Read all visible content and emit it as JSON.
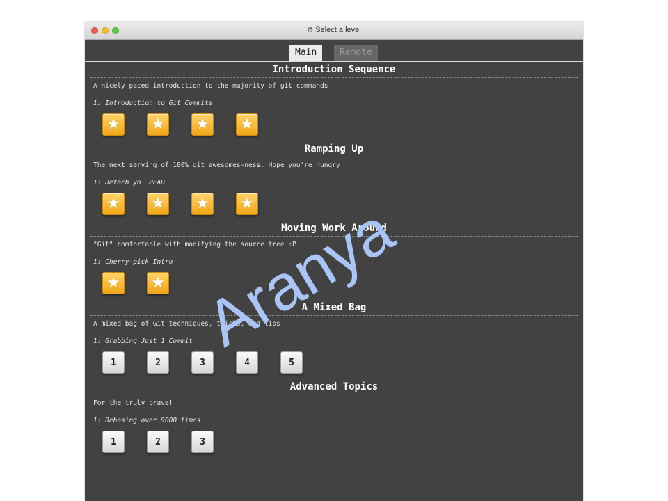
{
  "window": {
    "title": "Select a level"
  },
  "tabs": [
    {
      "label": "Main",
      "active": true
    },
    {
      "label": "Remote",
      "active": false
    }
  ],
  "sections": [
    {
      "title": "Introduction Sequence",
      "description": "A nicely paced introduction to the majority of git commands",
      "current_level": "1: Introduction to Git Commits",
      "levels": [
        "star",
        "star",
        "star",
        "star"
      ]
    },
    {
      "title": "Ramping Up",
      "description": "The next serving of 100% git awesomes-ness. Hope you're hungry",
      "current_level": "1: Detach yo' HEAD",
      "levels": [
        "star",
        "star",
        "star",
        "star"
      ]
    },
    {
      "title": "Moving Work Around",
      "description": "\"Git\" comfortable with modifying the source tree :P",
      "current_level": "1: Cherry-pick Intro",
      "levels": [
        "star",
        "star"
      ]
    },
    {
      "title": "A Mixed Bag",
      "description": "A mixed bag of Git techniques, tricks, and tips",
      "current_level": "1: Grabbing Just 1 Commit",
      "levels": [
        "1",
        "2",
        "3",
        "4",
        "5"
      ]
    },
    {
      "title": "Advanced Topics",
      "description": "For the truly brave!",
      "current_level": "1: Rebasing over 9000 times",
      "levels": [
        "1",
        "2",
        "3"
      ]
    }
  ],
  "watermark": {
    "text": "Aranya",
    "color": "#a9c4f5"
  },
  "colors": {
    "background": "#424242",
    "star_gold": "#f5b630",
    "tab_active": "#ececec"
  }
}
